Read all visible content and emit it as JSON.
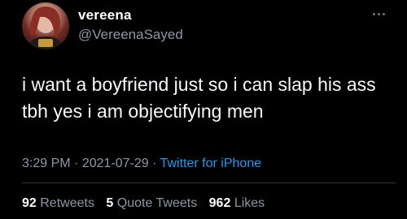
{
  "tweet": {
    "display_name": "vereena",
    "handle": "@VereenaSayed",
    "text": "i want a boyfriend just so i can slap his ass tbh yes i am objectifying men",
    "time": "3:29 PM",
    "separator": "·",
    "date": "2021-07-29",
    "source": "Twitter for iPhone",
    "stats": {
      "retweets_count": "92",
      "retweets_label": "Retweets",
      "quote_count": "5",
      "quote_label": "Quote Tweets",
      "likes_count": "962",
      "likes_label": "Likes"
    }
  },
  "colors": {
    "background": "#000000",
    "primary_text": "#e7e9ea",
    "secondary_text": "#8b98a5",
    "link": "#1d9bf0",
    "divider": "#2f3336"
  },
  "icons": {
    "more": "more-horizontal-icon"
  }
}
